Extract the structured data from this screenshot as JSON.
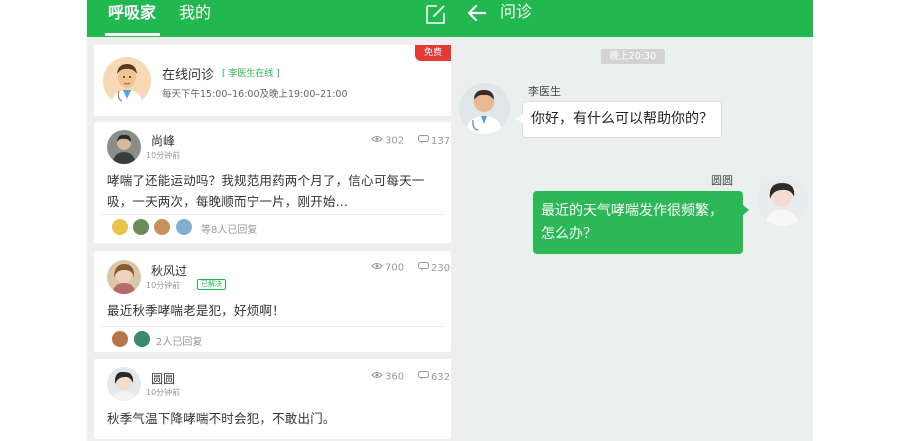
{
  "community": {
    "tabs": [
      "呼吸家",
      "我的"
    ],
    "consult": {
      "title": "在线问诊",
      "status": "[ 李医生在线 ]",
      "hours": "每天下午15:00–16:00及晚上19:00–21:00",
      "badge": "免费"
    },
    "posts": [
      {
        "author": "尚峰",
        "time": "10分钟前",
        "views": "302",
        "comments": "137",
        "body": "哮喘了还能运动吗？我规范用药两个月了，信心可每天一吸，一天两次，每晚顺而宁一片，刚开始...",
        "replies": "等8人已回复"
      },
      {
        "author": "秋风过",
        "time": "10分钟前",
        "badge": "已解决",
        "views": "700",
        "comments": "230",
        "body": "最近秋季哮喘老是犯，好烦啊！",
        "replies": "2人已回复"
      },
      {
        "author": "圆圆",
        "time": "10分钟前",
        "views": "360",
        "comments": "632",
        "body": "秋季气温下降哮喘不时会犯，不敢出门。"
      }
    ]
  },
  "chat": {
    "title": "问诊",
    "timestamp": "晚上20:30",
    "messages": [
      {
        "sender": "李医生",
        "text": "你好，有什么可以帮助你的？",
        "side": "left"
      },
      {
        "sender": "圆圆",
        "text": "最近的天气哮喘发作很频繁，怎么办？",
        "side": "right"
      }
    ]
  },
  "colors": {
    "accent": "#20b84f",
    "badge_red": "#e53935",
    "chat_bg": "#eaf0ee"
  },
  "icons": [
    "compose-icon",
    "back-arrow-icon",
    "eye-icon",
    "comment-icon"
  ]
}
